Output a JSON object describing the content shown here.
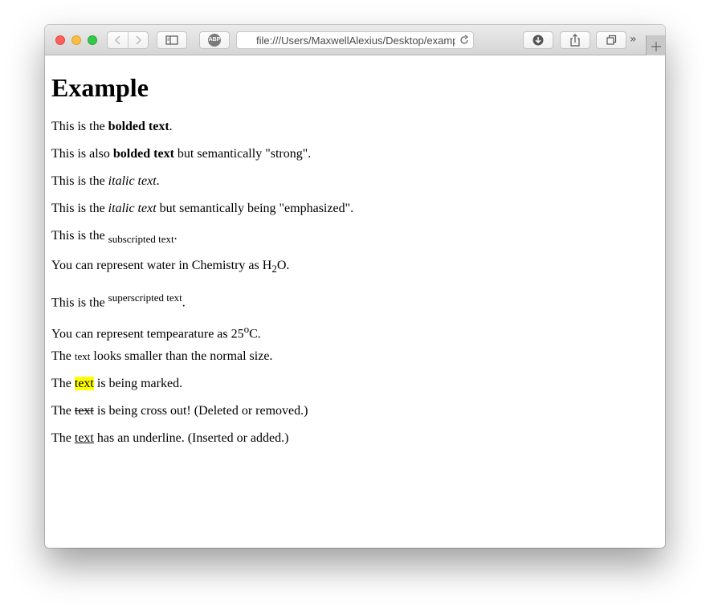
{
  "browser": {
    "url": "file:///Users/MaxwellAlexius/Desktop/example",
    "adblock_label": "ABP",
    "overflow_label": "»",
    "icons": {
      "back": "chevron-left-icon",
      "forward": "chevron-right-icon",
      "sidebar": "sidebar-icon",
      "adblock": "adblock-icon",
      "reload": "reload-icon",
      "download": "download-icon",
      "share": "share-icon",
      "tabs": "tabs-overview-icon",
      "new_tab": "plus-icon"
    },
    "colors": {
      "close": "#fc605c",
      "minimize": "#fdbc40",
      "zoom": "#34c84a",
      "mark": "#ffff00"
    }
  },
  "page": {
    "heading": "Example",
    "bold": {
      "before": "This is the ",
      "emph": "bolded text",
      "after": "."
    },
    "strong": {
      "before": "This is also ",
      "emph": "bolded text",
      "after": " but semantically \"strong\"."
    },
    "italic": {
      "before": "This is the ",
      "emph": "italic text",
      "after": "."
    },
    "em": {
      "before": "This is the ",
      "emph": "italic text",
      "after": " but semantically being \"emphasized\"."
    },
    "subscript": {
      "before": "This is the ",
      "sub": "subscripted text",
      "after": "."
    },
    "water": {
      "before": "You can represent water in Chemistry as H",
      "sub": "2",
      "after": "O."
    },
    "superscript": {
      "before": "This is the ",
      "sup": "superscripted text",
      "after": "."
    },
    "temperature": {
      "before": "You can represent tempearature as 25",
      "sup": "o",
      "after": "C."
    },
    "small": {
      "before": "The ",
      "small": "text",
      "after": " looks smaller than the normal size."
    },
    "marked": {
      "before": "The ",
      "mark": "text",
      "after": " is being marked."
    },
    "deleted": {
      "before": "The ",
      "del": "text",
      "after": " is being cross out! (Deleted or removed.)"
    },
    "inserted": {
      "before": "The ",
      "ins": "text",
      "after": " has an underline. (Inserted or added.)"
    }
  }
}
